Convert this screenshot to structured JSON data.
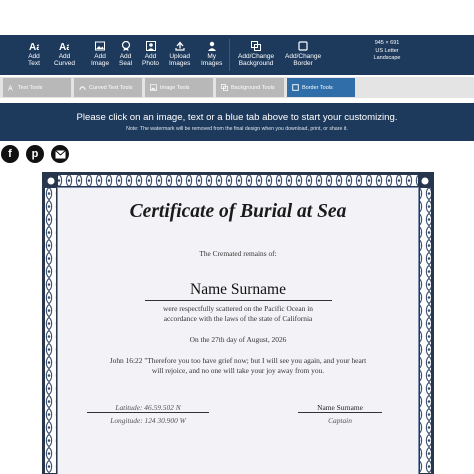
{
  "toolbar": {
    "buttons": [
      {
        "line1": "Add",
        "line2": "Text",
        "icon": "text-icon"
      },
      {
        "line1": "Add",
        "line2": "Curved",
        "icon": "curved-text-icon"
      },
      {
        "line1": "Add",
        "line2": "Image",
        "icon": "image-icon"
      },
      {
        "line1": "Add",
        "line2": "Seal",
        "icon": "seal-icon"
      },
      {
        "line1": "Add",
        "line2": "Photo",
        "icon": "photo-icon"
      },
      {
        "line1": "Upload",
        "line2": "Images",
        "icon": "upload-icon"
      },
      {
        "line1": "My",
        "line2": "Images",
        "icon": "user-icon"
      },
      {
        "line1": "Add/Change",
        "line2": "Background",
        "icon": "background-icon"
      },
      {
        "line1": "Add/Change",
        "line2": "Border",
        "icon": "border-icon"
      }
    ],
    "size": {
      "dims": "945 × 691",
      "paper": "US Letter",
      "orientation": "Landscape"
    }
  },
  "tabs": [
    {
      "label": "Text Tools",
      "active": false
    },
    {
      "label": "Curved Text Tools",
      "active": false
    },
    {
      "label": "Image Tools",
      "active": false
    },
    {
      "label": "Background Tools",
      "active": false
    },
    {
      "label": "Border Tools",
      "active": true
    }
  ],
  "banner": {
    "main": "Please click on an image, text or a blue tab above to start your customizing.",
    "note": "Note: The watermark will be removed from the final design when you download, print, or share it."
  },
  "social": [
    {
      "glyph": "f",
      "icon": "facebook-icon"
    },
    {
      "glyph": "p",
      "icon": "pinterest-icon"
    },
    {
      "glyph": "",
      "icon": "email-icon"
    }
  ],
  "certificate": {
    "title": "Certificate of Burial at Sea",
    "subtitle": "The Cremated remains of:",
    "name": "Name Surname",
    "line1": "were respectfully scattered on the Pacific Ocean in",
    "line2": "accordance with the laws of the state of California",
    "date": "On the 27th day of August, 2026",
    "verse1": "John 16:22 \"Therefore you too have grief now; but I will see you again, and your heart",
    "verse2": "will rejoice, and no one will take your joy away from you.",
    "latitude": "Latitude: 46.59.502 N",
    "longitude": "Longitude: 124 30.900 W",
    "signer_name": "Name Surname",
    "signer_title": "Captain"
  },
  "colors": {
    "toolbar": "#1d3a5c",
    "tab_active": "#2f6ea8",
    "tab_inactive": "#b8b8b8",
    "border_ornament": "#27364d"
  }
}
